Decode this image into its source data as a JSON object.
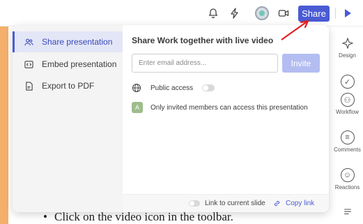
{
  "toolbar": {
    "share_label": "Share",
    "icons": [
      "bell-icon",
      "lightning-icon",
      "avatar",
      "video-icon",
      "play-icon"
    ],
    "accent_color": "#4a5bd4"
  },
  "share_panel": {
    "menu": [
      {
        "label": "Share presentation",
        "icon": "users-icon",
        "active": true
      },
      {
        "label": "Embed presentation",
        "icon": "embed-icon",
        "active": false
      },
      {
        "label": "Export to PDF",
        "icon": "pdf-icon",
        "active": false
      }
    ],
    "heading": "Share Work together with live video",
    "email_placeholder": "Enter email address...",
    "email_value": "",
    "invite_label": "Invite",
    "public_access_label": "Public access",
    "public_access_on": false,
    "member_initial": "A",
    "member_text": "Only invited members can access this presentation",
    "link_to_slide_label": "Link to current slide",
    "link_to_slide_on": false,
    "copy_link_label": "Copy link"
  },
  "right_rail": [
    {
      "label": "Design",
      "icon": "design-icon"
    },
    {
      "label": "",
      "icon": "check-icon"
    },
    {
      "label": "Workflow",
      "icon": "workflow-icon"
    },
    {
      "label": "Comments",
      "icon": "comment-icon"
    },
    {
      "label": "Reactions",
      "icon": "smile-icon"
    },
    {
      "label": "",
      "icon": "notes-icon"
    }
  ],
  "slide": {
    "bullet_text": "Click on the video icon in the toolbar."
  }
}
